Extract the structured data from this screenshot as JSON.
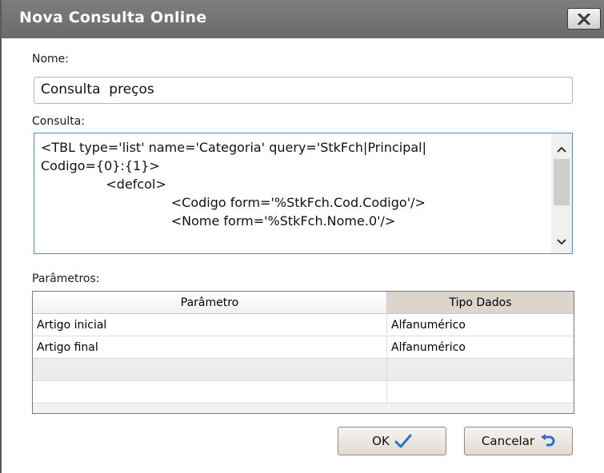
{
  "window": {
    "title": "Nova Consulta Online"
  },
  "form": {
    "name_label": "Nome:",
    "name_value": "Consulta  preços",
    "query_label": "Consulta:",
    "query_lines": [
      "<TBL type='list' name='Categoria' query='StkFch|Principal|",
      "Codigo={0}:{1}>",
      "                <defcol>",
      "                                <Codigo form='%StkFch.Cod.Codigo'/>",
      "                                <Nome form='%StkFch.Nome.0'/>"
    ],
    "params_label": "Parâmetros:"
  },
  "grid": {
    "columns": [
      "Parâmetro",
      "Tipo Dados"
    ],
    "rows": [
      {
        "param": "Artigo inicial",
        "type": "Alfanumérico"
      },
      {
        "param": "Artigo final",
        "type": "Alfanumérico"
      },
      {
        "param": "",
        "type": ""
      },
      {
        "param": "",
        "type": ""
      }
    ]
  },
  "buttons": {
    "ok": "OK",
    "cancel": "Cancelar"
  },
  "colors": {
    "titlebar": "#737373",
    "ok_check": "#2f6fc9",
    "cancel_arrow": "#2f6fc9",
    "focus_border": "#4a90d9"
  },
  "icons": {
    "close": "close-icon",
    "ok": "checkmark-icon",
    "cancel": "undo-arrow-icon"
  }
}
